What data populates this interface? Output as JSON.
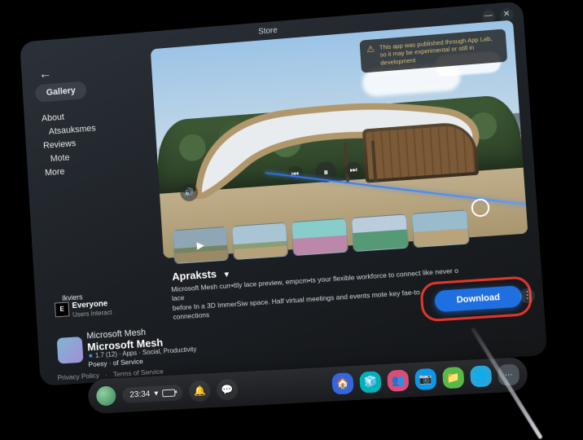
{
  "window": {
    "title": "Store",
    "back_icon": "←",
    "minimize": "—",
    "close": "✕"
  },
  "gallery_chip": "Gallery",
  "nav": {
    "about": "About",
    "atsauksmes": "Atsauksmes",
    "reviews": "Reviews",
    "mote": "Mote",
    "more": "More"
  },
  "warn": {
    "icon": "⚠",
    "text": "This app was published through App Lab, so it may be experimental or still in development"
  },
  "hero_controls": {
    "volume": "🔊",
    "prev": "⏮",
    "play": "⏸",
    "next": "⏭"
  },
  "section_title": "Apraksts",
  "section_caret": "▾",
  "description_line1": "Microsoft Mesh curr•ttly lace preview, empcm•ts your flexible workforce to connect like never o lace",
  "description_line2": "before In a 3D ImmerSiw space. Half virtual meetings and events mote key fae-to",
  "description_line3": "connections",
  "download_label": "Download",
  "kebab": "⋮",
  "audience_label": "Ikviers",
  "rating_symbol": "E",
  "rating_text": "Everyone",
  "rating_sub": "Users Interact",
  "app": {
    "line1": "Microsoft Mesh",
    "line2": "Microsoft Mesh",
    "star": "★",
    "meta": "1.7 (12)  ·  Apps · Social, Productivity",
    "tos": "Poesy · of Service"
  },
  "footer": {
    "privacy": "Privacy Policy",
    "sep": "·",
    "terms": "Terms of Service"
  },
  "taskbar": {
    "time": "23:34",
    "caret": "▾",
    "bell": "🔔",
    "msg": "💬",
    "apps": {
      "a1": "🏠",
      "a2": "🧊",
      "a3": "👥",
      "a4": "📷",
      "a5": "📁",
      "a5b": "🌐",
      "a6": "⋯"
    }
  }
}
